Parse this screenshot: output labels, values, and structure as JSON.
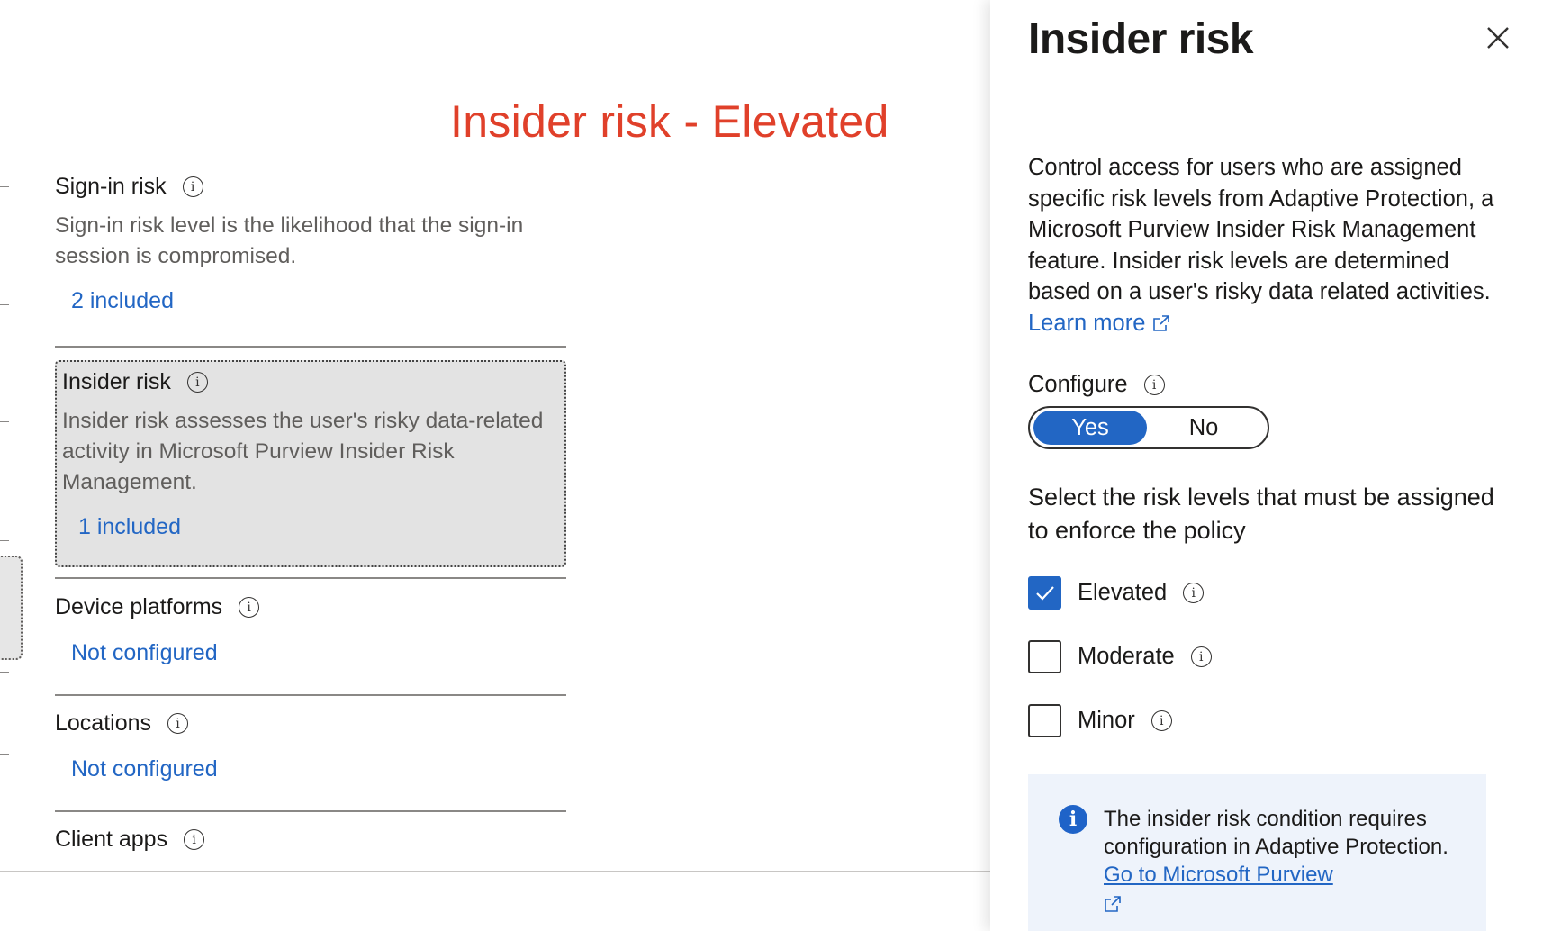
{
  "annotation": {
    "title": "Insider risk - Elevated"
  },
  "conditions": [
    {
      "title": "Sign-in risk",
      "description": "Sign-in risk level is the likelihood that the sign-in session is compromised.",
      "value": "2 included"
    },
    {
      "title": "Insider risk",
      "description": "Insider risk assesses the user's risky data-related activity in Microsoft Purview Insider Risk Management.",
      "value": "1 included"
    },
    {
      "title": "Device platforms",
      "value": "Not configured"
    },
    {
      "title": "Locations",
      "value": "Not configured"
    },
    {
      "title": "Client apps"
    }
  ],
  "panel": {
    "title": "Insider risk",
    "description": "Control access for users who are assigned specific risk levels from Adaptive Protection, a Microsoft Purview Insider Risk Management feature. Insider risk levels are determined based on a user's risky data related activities.",
    "learn_more": "Learn more",
    "configure_label": "Configure",
    "toggle": {
      "yes": "Yes",
      "no": "No",
      "selected": "Yes"
    },
    "select_label": "Select the risk levels that must be assigned to enforce the policy",
    "risk_levels": [
      {
        "label": "Elevated",
        "checked": true
      },
      {
        "label": "Moderate",
        "checked": false
      },
      {
        "label": "Minor",
        "checked": false
      }
    ],
    "info_box": {
      "text": "The insider risk condition requires configuration in Adaptive Protection.",
      "link": "Go to Microsoft Purview"
    }
  },
  "colors": {
    "accent": "#2266c4",
    "annotation": "#e0402a",
    "info_bg": "#eef3fb"
  },
  "icons": [
    "info-icon",
    "close-icon",
    "external-link-icon",
    "checkmark-icon",
    "info-filled-icon"
  ]
}
